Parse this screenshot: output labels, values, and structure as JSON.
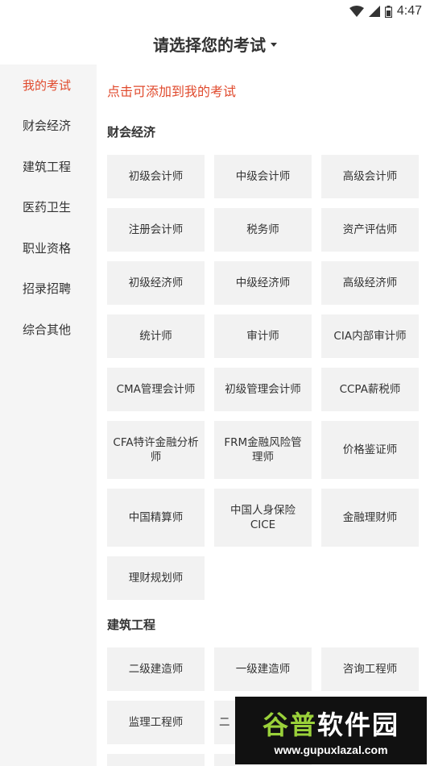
{
  "status_bar": {
    "time": "4:47"
  },
  "header": {
    "title": "请选择您的考试"
  },
  "sidebar": {
    "items": [
      {
        "label": "我的考试"
      },
      {
        "label": "财会经济"
      },
      {
        "label": "建筑工程"
      },
      {
        "label": "医药卫生"
      },
      {
        "label": "职业资格"
      },
      {
        "label": "招录招聘"
      },
      {
        "label": "综合其他"
      }
    ]
  },
  "main": {
    "hint": "点击可添加到我的考试",
    "sections": [
      {
        "title": "财会经济",
        "exams": [
          "初级会计师",
          "中级会计师",
          "高级会计师",
          "注册会计师",
          "税务师",
          "资产评估师",
          "初级经济师",
          "中级经济师",
          "高级经济师",
          "统计师",
          "审计师",
          "CIA内部审计师",
          "CMA管理会计师",
          "初级管理会计师",
          "CCPA薪税师",
          "CFA特许金融分析师",
          "FRM金融风险管理师",
          "价格鉴证师",
          "中国精算师",
          "中国人身保险CICE",
          "金融理财师",
          "理财规划师"
        ]
      },
      {
        "title": "建筑工程",
        "exams": [
          "二级建造师",
          "一级建造师",
          "咨询工程师",
          "监理工程师",
          "二"
        ]
      }
    ]
  },
  "watermark": {
    "brand_part1": "谷普",
    "brand_part2": "软件园",
    "url": "www.gupuxlazal.com"
  }
}
